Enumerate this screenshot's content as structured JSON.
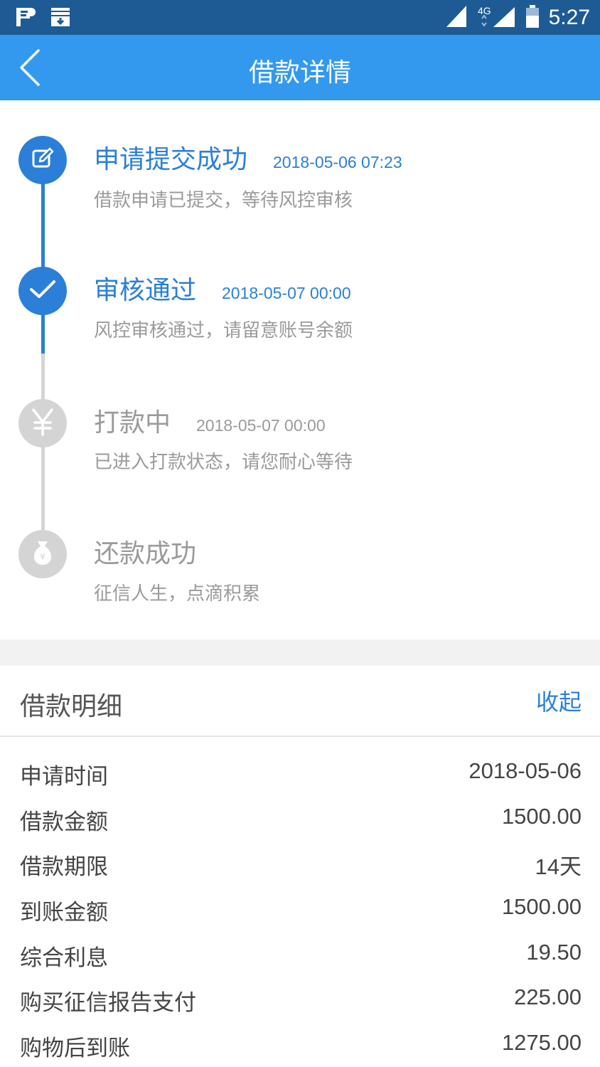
{
  "status_bar": {
    "time": "5:27",
    "network": "4G",
    "icons": [
      "notification-flag-icon",
      "download-tray-icon",
      "signal-icon",
      "signal-4g-icon",
      "battery-icon"
    ]
  },
  "app_bar": {
    "title": "借款详情",
    "back_icon": "chevron-left-icon"
  },
  "timeline": [
    {
      "title": "申请提交成功",
      "time": "2018-05-06 07:23",
      "desc": "借款申请已提交，等待风控审核",
      "state": "active",
      "icon": "edit-icon"
    },
    {
      "title": "审核通过",
      "time": "2018-05-07 00:00",
      "desc": "风控审核通过，请留意账号余额",
      "state": "active",
      "icon": "check-icon"
    },
    {
      "title": "打款中",
      "time": "2018-05-07 00:00",
      "desc": "已进入打款状态，请您耐心等待",
      "state": "inactive",
      "icon": "yen-icon"
    },
    {
      "title": "还款成功",
      "time": "",
      "desc": "征信人生，点滴积累",
      "state": "inactive",
      "icon": "money-bag-icon"
    }
  ],
  "details": {
    "title": "借款明细",
    "collapse_label": "收起",
    "rows": [
      {
        "label": "申请时间",
        "value": "2018-05-06"
      },
      {
        "label": "借款金额",
        "value": "1500.00"
      },
      {
        "label": "借款期限",
        "value": "14天"
      },
      {
        "label": "到账金额",
        "value": "1500.00"
      },
      {
        "label": "综合利息",
        "value": "19.50"
      },
      {
        "label": "购买征信报告支付",
        "value": "225.00"
      },
      {
        "label": "购物后到账",
        "value": "1275.00"
      }
    ]
  },
  "colors": {
    "status_bar": "#1e5b94",
    "app_bar": "#3399ee",
    "accent": "#2b7fd8",
    "inactive": "#d4d4d4"
  }
}
